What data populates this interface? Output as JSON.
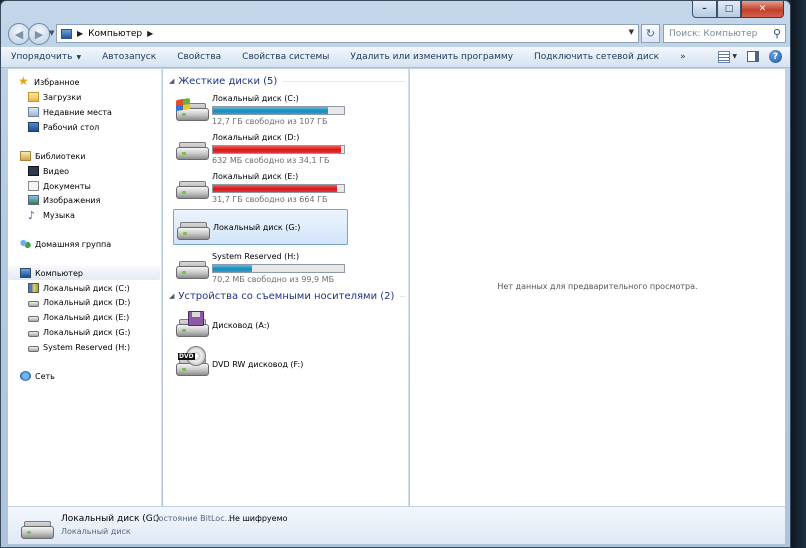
{
  "window": {
    "caption": {
      "minimize": "–",
      "maximize": "□",
      "close": "✕"
    }
  },
  "address": {
    "crumbs": [
      "Компьютер"
    ],
    "search_placeholder": "Поиск: Компьютер"
  },
  "toolbar": {
    "items": [
      "Упорядочить",
      "Автозапуск",
      "Свойства",
      "Свойства системы",
      "Удалить или изменить программу",
      "Подключить сетевой диск",
      "»"
    ]
  },
  "nav": {
    "favorites": {
      "label": "Избранное",
      "items": [
        "Загрузки",
        "Недавние места",
        "Рабочий стол"
      ]
    },
    "libraries": {
      "label": "Библиотеки",
      "items": [
        "Видео",
        "Документы",
        "Изображения",
        "Музыка"
      ]
    },
    "homegroup": "Домашняя группа",
    "computer": {
      "label": "Компьютер",
      "items": [
        "Локальный диск (C:)",
        "Локальный диск (D:)",
        "Локальный диск (E:)",
        "Локальный диск (G:)",
        "System Reserved (H:)"
      ]
    },
    "network": "Сеть"
  },
  "content": {
    "hard_disks_header": "Жесткие диски (5)",
    "removable_header": "Устройства со съемными носителями (2)",
    "drives": [
      {
        "name": "Локальный диск (C:)",
        "free": "12,7 ГБ свободно из 107 ГБ",
        "used_fraction": 0.88,
        "bar_color": "blue"
      },
      {
        "name": "Локальный диск (D:)",
        "free": "632 МБ свободно из 34,1 ГБ",
        "used_fraction": 0.98,
        "bar_color": "red"
      },
      {
        "name": "Локальный диск (E:)",
        "free": "31,7 ГБ свободно из 664 ГБ",
        "used_fraction": 0.95,
        "bar_color": "red"
      },
      {
        "name": "Локальный диск (G:)"
      },
      {
        "name": "System Reserved (H:)",
        "free": "70,2 МБ свободно из 99,9 МБ",
        "used_fraction": 0.3,
        "bar_color": "blue"
      }
    ],
    "removable": [
      {
        "name": "Дисковод (A:)"
      },
      {
        "name": "DVD RW дисковод (F:)",
        "badge": "DVD"
      }
    ]
  },
  "preview": {
    "text": "Нет данных для предварительного просмотра."
  },
  "details": {
    "name": "Локальный диск (G:)",
    "label": "Состояние BitLoc...",
    "value": "Не шифруемо",
    "type": "Локальный диск"
  }
}
